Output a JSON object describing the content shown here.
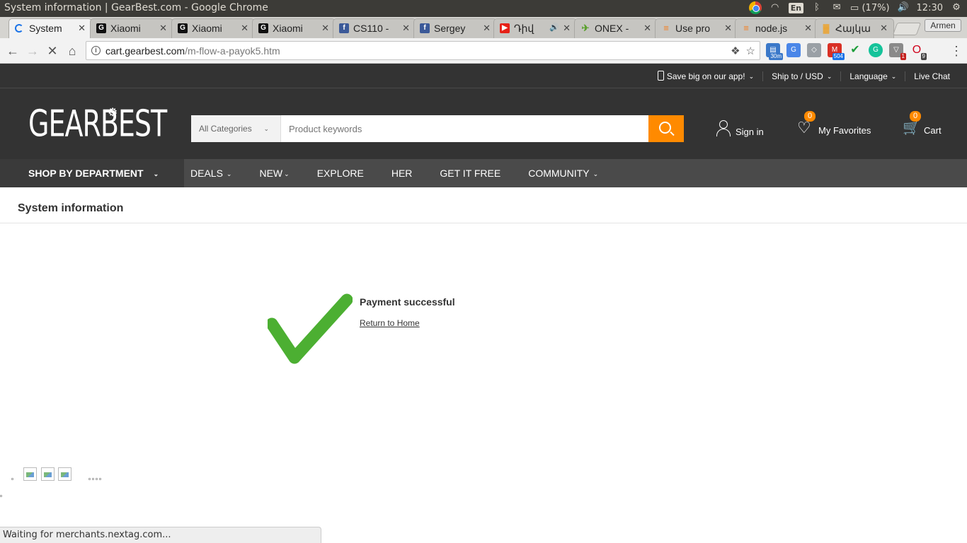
{
  "os": {
    "window_title": "System information | GearBest.com - Google Chrome",
    "lang": "En",
    "battery": "(17%)",
    "time": "12:30"
  },
  "tabs": [
    {
      "label": "System",
      "active": true,
      "icon": "loading-spinner-icon",
      "color": "#1a73e8"
    },
    {
      "label": "Xiaomi",
      "icon": "gearbest-icon",
      "color": "#111111"
    },
    {
      "label": "Xiaomi",
      "icon": "gearbest-icon",
      "color": "#111111"
    },
    {
      "label": "Xiaomi",
      "icon": "gearbest-icon",
      "color": "#111111"
    },
    {
      "label": "CS110 -",
      "icon": "facebook-icon",
      "color": "#3b5998"
    },
    {
      "label": "Sergey",
      "icon": "facebook-icon",
      "color": "#3b5998"
    },
    {
      "label": "Դիվ",
      "icon": "youtube-icon",
      "color": "#e62117"
    },
    {
      "label": "ONEX -",
      "icon": "onex-icon",
      "color": "#5aa02c"
    },
    {
      "label": "Use pro",
      "icon": "stackoverflow-icon",
      "color": "#f48024"
    },
    {
      "label": "node.js",
      "icon": "stackoverflow-icon",
      "color": "#f48024"
    },
    {
      "label": "Հայկա",
      "icon": "grid-icon",
      "color": "#f0a020"
    }
  ],
  "profile": "Armen",
  "address": {
    "host": "cart.gearbest.com",
    "path": "/m-flow-a-payok5.htm"
  },
  "extensions": [
    {
      "icon": "calendar-ext-icon",
      "color": "#3a78c9",
      "badge": "30m",
      "badge_color": "#3a78c9"
    },
    {
      "icon": "translate-ext-icon",
      "color": "#4a86e8"
    },
    {
      "icon": "tag-ext-icon",
      "color": "#9aa0a6"
    },
    {
      "icon": "gmail-ext-icon",
      "color": "#d93025",
      "badge": "504",
      "badge_color": "#1a73e8"
    },
    {
      "icon": "check-ext-icon",
      "color": "#1e9e3b"
    },
    {
      "icon": "grammarly-ext-icon",
      "color": "#15c39a"
    },
    {
      "icon": "shield-ext-icon",
      "color": "#8a8a8a",
      "badge": "1",
      "badge_color": "#c5221f"
    },
    {
      "icon": "opera-ext-icon",
      "color": "#d0021b",
      "badge": "9",
      "badge_color": "#444444"
    }
  ],
  "site": {
    "util": {
      "app": "Save big on our app!",
      "ship": "Ship to / USD",
      "language": "Language",
      "chat": "Live Chat"
    },
    "logo": "GEARBEST",
    "search": {
      "category": "All Categories",
      "placeholder": "Product keywords"
    },
    "header": {
      "sign_in": "Sign in",
      "favorites": "My Favorites",
      "favorites_count": "0",
      "cart": "Cart",
      "cart_count": "0"
    },
    "nav": {
      "department": "SHOP BY DEPARTMENT",
      "links": [
        "DEALS",
        "NEW",
        "EXPLORE",
        "HER",
        "GET IT FREE",
        "COMMUNITY"
      ]
    },
    "accent": "#ff8a00"
  },
  "content": {
    "title": "System information",
    "message": "Payment successful",
    "return_link": "Return to Home",
    "check_color": "#4caf32"
  },
  "status": "Waiting for merchants.nextag.com..."
}
